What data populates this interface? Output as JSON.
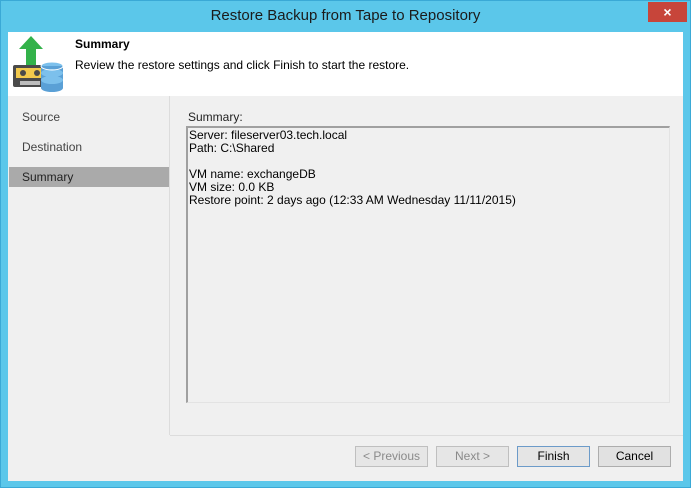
{
  "window": {
    "title": "Restore Backup from Tape to Repository",
    "close_glyph": "×"
  },
  "header": {
    "icon": "tape-restore-icon",
    "title": "Summary",
    "description": "Review the restore settings and click Finish to start the restore."
  },
  "nav": {
    "items": [
      {
        "label": "Source"
      },
      {
        "label": "Destination"
      },
      {
        "label": "Summary",
        "active": true
      }
    ]
  },
  "summary": {
    "label": "Summary:",
    "lines": [
      "Server: fileserver03.tech.local",
      "Path: C:\\Shared",
      "",
      "VM name: exchangeDB",
      "VM size: 0.0 KB",
      "Restore point: 2 days ago (12:33 AM Wednesday 11/11/2015)"
    ]
  },
  "buttons": {
    "previous": "< Previous",
    "next": "Next >",
    "finish": "Finish",
    "cancel": "Cancel"
  },
  "colors": {
    "accent": "#5bc7ea",
    "close": "#c7453a",
    "arrow": "#33b24a",
    "disk": "#5aa0d6"
  }
}
